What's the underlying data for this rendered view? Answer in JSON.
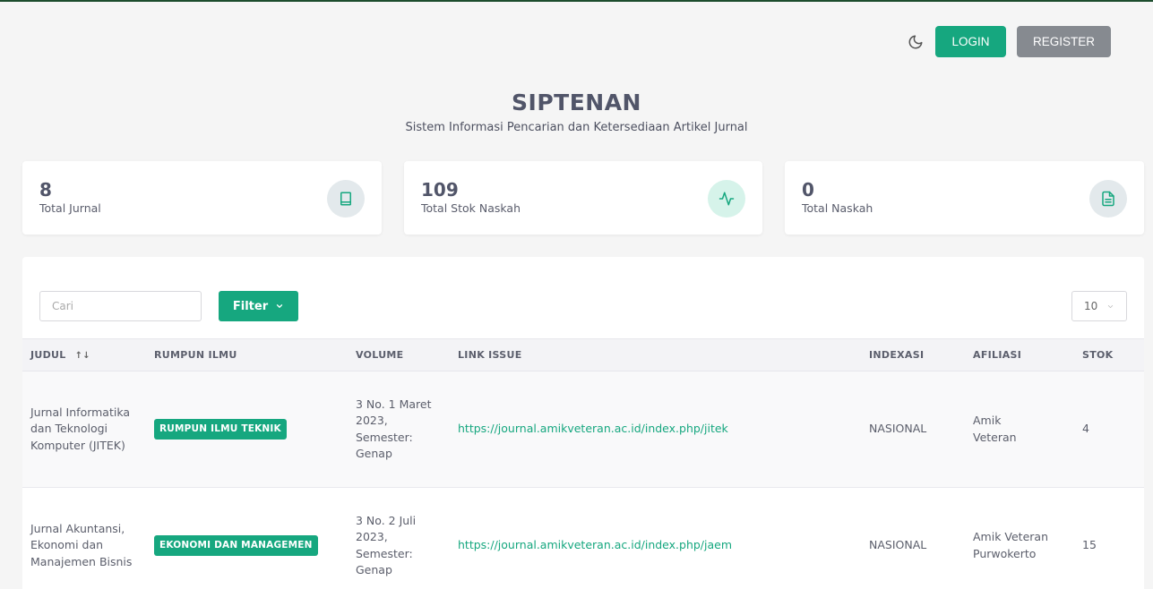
{
  "nav": {
    "login_label": "LOGIN",
    "register_label": "REGISTER",
    "theme_icon": "moon-icon"
  },
  "header": {
    "title": "SIPTENAN",
    "subtitle": "Sistem Informasi Pencarian dan Ketersediaan Artikel Jurnal"
  },
  "stats": [
    {
      "value": "8",
      "label": "Total Jurnal",
      "icon": "book-icon"
    },
    {
      "value": "109",
      "label": "Total Stok Naskah",
      "icon": "activity-icon"
    },
    {
      "value": "0",
      "label": "Total Naskah",
      "icon": "file-text-icon"
    }
  ],
  "toolbar": {
    "search_placeholder": "Cari",
    "filter_label": "Filter",
    "page_size": "10"
  },
  "table": {
    "headers": [
      "JUDUL",
      "RUMPUN ILMU",
      "VOLUME",
      "LINK ISSUE",
      "INDEXASI",
      "AFILIASI",
      "STOK"
    ],
    "rows": [
      {
        "judul": "Jurnal Informatika dan Teknologi Komputer (JITEK)",
        "rumpun": "RUMPUN ILMU TEKNIK",
        "volume": "3 No. 1 Maret 2023, Semester: Genap",
        "link": "https://journal.amikveteran.ac.id/index.php/jitek",
        "indexasi": "NASIONAL",
        "afiliasi": "Amik Veteran",
        "stok": "4"
      },
      {
        "judul": "Jurnal Akuntansi, Ekonomi dan Manajemen Bisnis",
        "rumpun": "EKONOMI DAN MANAGEMEN",
        "volume": "3 No. 2 Juli 2023, Semester: Genap",
        "link": "https://journal.amikveteran.ac.id/index.php/jaem",
        "indexasi": "NASIONAL",
        "afiliasi": "Amik Veteran Purwokerto",
        "stok": "15"
      }
    ]
  },
  "colors": {
    "accent": "#16a77f",
    "secondary": "#868a90"
  }
}
